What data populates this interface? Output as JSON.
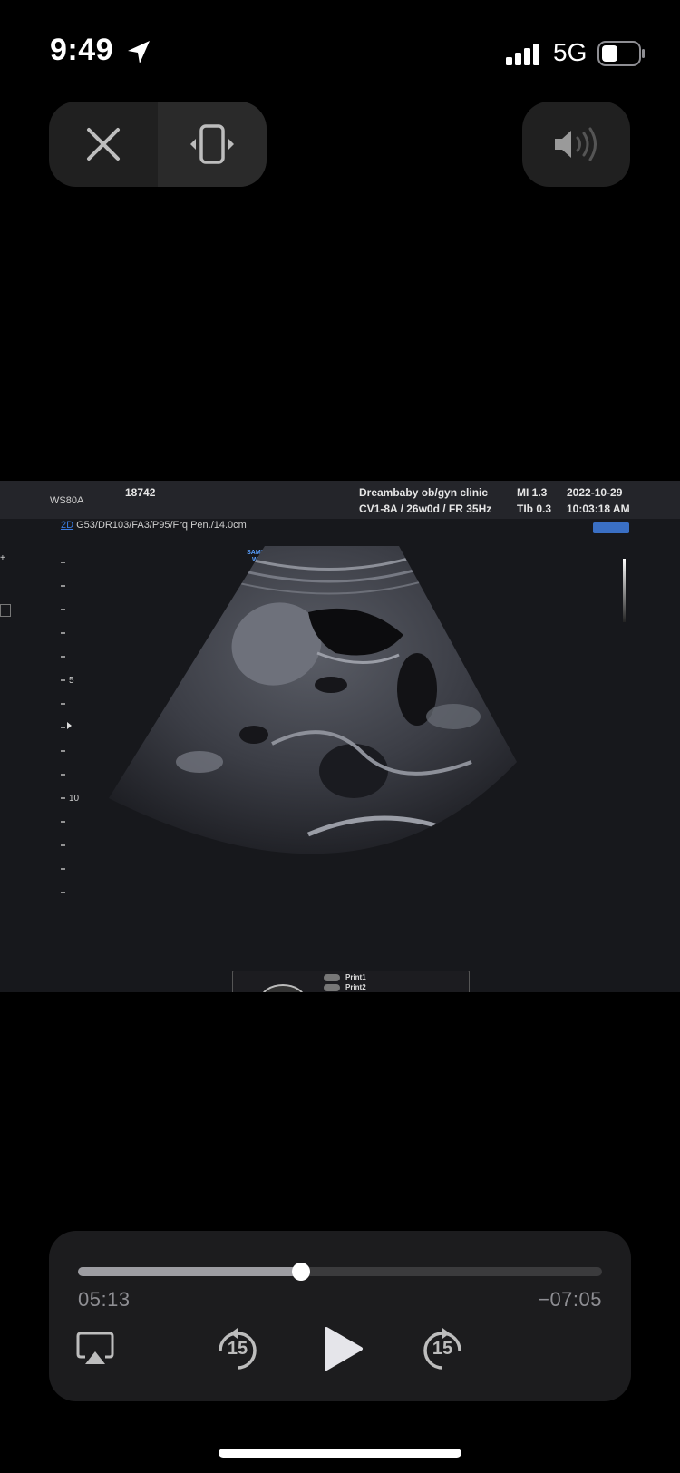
{
  "status_bar": {
    "time": "9:49",
    "network": "5G"
  },
  "player_top": {
    "close_icon": "close-icon",
    "orientation_icon": "rotate-device-icon",
    "volume_icon": "speaker-muted-icon"
  },
  "ultrasound": {
    "model": "WS80A",
    "patient_id": "18742",
    "clinic": "Dreambaby ob/gyn clinic",
    "probe_info": "CV1-8A / 26w0d / FR 35Hz",
    "mi": "MI  1.3",
    "tib": "TIb 0.3",
    "date": "2022-10-29",
    "time": "10:03:18 AM",
    "mode": "2D",
    "params": "G53/DR103/FA3/P95/Frq Pen./14.0cm",
    "brand_line1": "SAMSUNG",
    "brand_line2": "WS80A",
    "scale_5": "5",
    "scale_10": "10",
    "print1": "Print1",
    "print2": "Print2"
  },
  "playback": {
    "elapsed": "05:13",
    "remaining": "−07:05",
    "progress": 0.426,
    "skip_back": "15",
    "skip_forward": "15"
  },
  "colors": {
    "background": "#000000",
    "panel": "#1c1c1e",
    "accent_blue": "#3a7be0"
  }
}
